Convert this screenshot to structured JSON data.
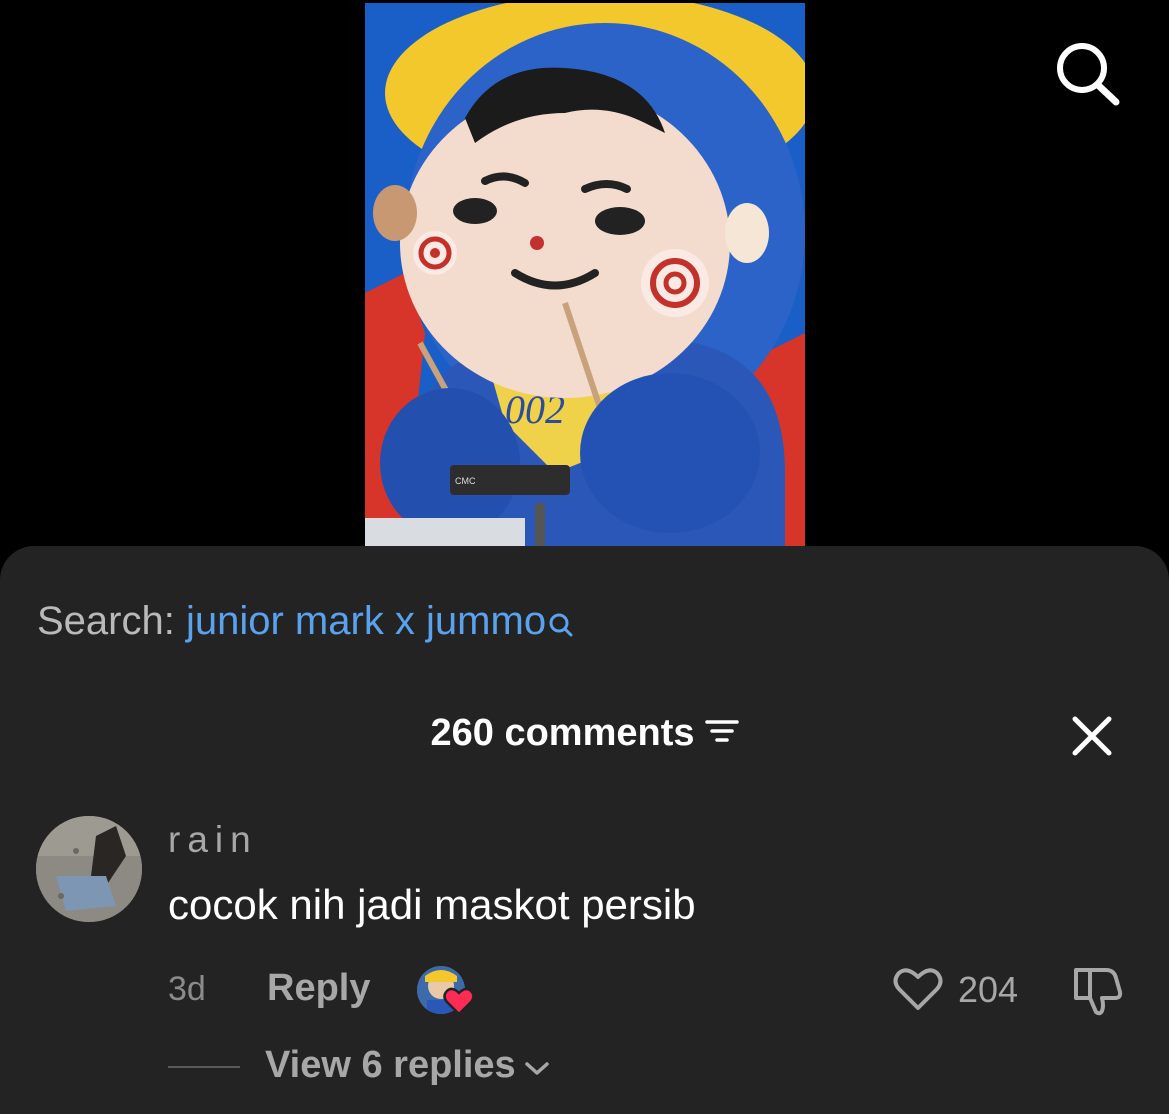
{
  "search": {
    "prefix": "Search:",
    "query": "junior mark x jummo"
  },
  "comments": {
    "count_label": "260 comments"
  },
  "comment": {
    "username": "rain",
    "text": "cocok nih jadi maskot persib",
    "time": "3d",
    "reply_label": "Reply",
    "like_count": "204",
    "view_replies_label": "View 6 replies"
  },
  "icons": {
    "top_right": "search-icon",
    "search_suffix": "search-icon",
    "sort": "sort-lines-icon",
    "close": "close-icon",
    "like": "heart-outline-icon",
    "dislike": "thumbs-down-icon",
    "creator_liked": "heart-filled-icon",
    "expand": "chevron-down-icon"
  },
  "colors": {
    "background": "#000000",
    "sheet": "#232323",
    "link": "#5aa2ee",
    "text_primary": "#ffffff",
    "text_secondary": "#a7a7a7",
    "heart": "#fe2c55"
  }
}
